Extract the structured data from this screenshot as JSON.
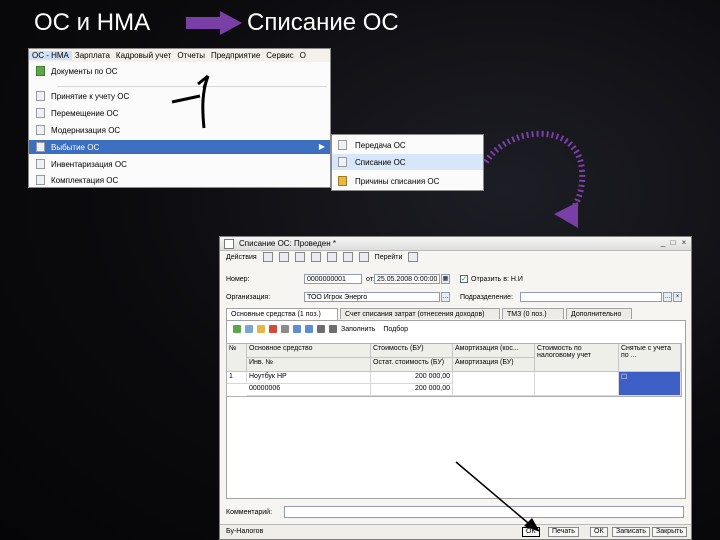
{
  "slide": {
    "title_left": "ОС и НМА",
    "title_right": "Списание ОС",
    "arrow_color": "#7a3fa6"
  },
  "menu_screenshot": {
    "menubar": [
      "ОС - НМА",
      "Зарплата",
      "Кадровый учет",
      "Отчеты",
      "Предприятие",
      "Сервис",
      "О"
    ],
    "items": [
      {
        "label": "Документы по ОС",
        "icon": "document-icon"
      },
      {
        "label": "Принятие к учету ОС",
        "icon": "document-icon"
      },
      {
        "label": "Перемещение ОС",
        "icon": "document-icon"
      },
      {
        "label": "Модернизация ОС",
        "icon": "document-icon"
      },
      {
        "label": "Выбытие ОС",
        "icon": "document-icon",
        "highlighted": true,
        "has_submenu": true
      },
      {
        "label": "Инвентаризация ОС",
        "icon": "document-icon"
      },
      {
        "label": "Комплектация ОС",
        "icon": "document-icon"
      }
    ],
    "submenu": [
      {
        "label": "Передача ОС",
        "icon": "document-icon"
      },
      {
        "label": "Списание ОС",
        "icon": "document-icon",
        "highlighted": true
      },
      {
        "label": "Причины списания ОС",
        "icon": "printer-icon"
      }
    ]
  },
  "form": {
    "title": "Списание ОС: Проведен *",
    "toolbar": {
      "actions": "Действия",
      "go": "Перейти"
    },
    "number_label": "Номер:",
    "number_value": "0000000001",
    "date_label": "от:",
    "date_value": "25.05.2008 0:00:00",
    "checkbox_label": "Отразить в: Н.И",
    "checkbox_checked": "✓",
    "org_label": "Организация:",
    "org_value": "ТОО Игрок Энерго",
    "division_label": "Подразделение:",
    "division_value": "",
    "tabs": [
      {
        "label": "Основные средства (1 поз.)",
        "active": true
      },
      {
        "label": "Счет списания затрат (отнесения доходов)"
      },
      {
        "label": "ТМЗ (0 поз.)"
      },
      {
        "label": "Дополнительно"
      }
    ],
    "tab_toolbar": {
      "fill": "Заполнить",
      "select": "Подбор"
    },
    "grid": {
      "headers_row1": [
        "№",
        "Основное средство",
        "Стоимость (БУ)",
        "Амортизация (кос...",
        "Стоимость по налоговому учет",
        "Снятые с учета по ..."
      ],
      "headers_row2": [
        "",
        "Инв. №",
        "Остат. стоимость (БУ)",
        "Амортизация (БУ)",
        "",
        ""
      ],
      "rows": [
        {
          "num": "1",
          "asset": "Ноутбук HP",
          "inv": "00000006",
          "cost": "200 000,00",
          "residual": "200 000,00",
          "amort": "",
          "tax": "",
          "removed": "☐"
        }
      ]
    },
    "comment_label": "Комментарий:",
    "bottom": {
      "doc_type": "Бу-Налогов",
      "ok": "ОК",
      "print": "Печать",
      "ok2": "ОК",
      "save": "Записать",
      "close": "Закрыть"
    }
  }
}
